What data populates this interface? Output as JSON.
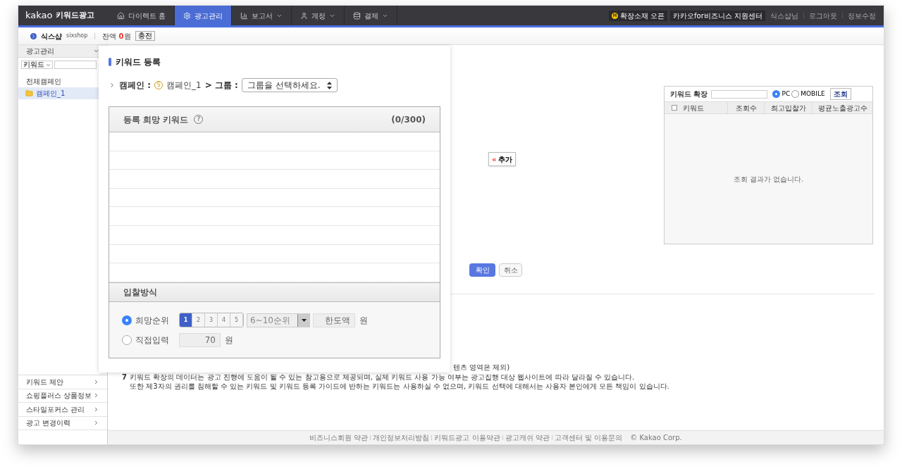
{
  "nav": {
    "logo_brand": "kakao",
    "logo_product": "키워드광고",
    "tabs": [
      {
        "label": "다이렉트 홈",
        "selected": false,
        "dropdown": false
      },
      {
        "label": "광고관리",
        "selected": true,
        "dropdown": false
      },
      {
        "label": "보고서",
        "selected": false,
        "dropdown": true
      },
      {
        "label": "계정",
        "selected": false,
        "dropdown": true
      },
      {
        "label": "결제",
        "selected": false,
        "dropdown": true
      }
    ],
    "badge_mark": "H",
    "badge": "확장소재 오픈",
    "support": "카카오for비즈니스 지원센터",
    "user_links": [
      "식스샵님",
      "로그아웃",
      "정보수정"
    ]
  },
  "account": {
    "name": "식스샵",
    "id": "sixshop",
    "balance_label": "잔액",
    "balance_amount": "0",
    "balance_unit": "원",
    "charge_button": "충전"
  },
  "sidebar": {
    "header": "광고관리",
    "search_select": "키워드",
    "tree": [
      {
        "label": "전체캠페인",
        "selected": false,
        "children": [
          {
            "label": "캠페인_1",
            "selected": true
          }
        ]
      }
    ],
    "menu": [
      "키워드 제안",
      "쇼핑플러스 상품정보",
      "스타일포커스 관리",
      "광고 변경이력"
    ]
  },
  "page": {
    "add_icon": "«",
    "add_button": "추가",
    "keyword_extension": {
      "label": "키워드 확장",
      "radios": [
        {
          "label": "PC",
          "selected": true
        },
        {
          "label": "MOBILE",
          "selected": false
        }
      ],
      "search_button": "조회",
      "select_all_checked": false,
      "columns": [
        "키워드",
        "조회수",
        "최고입찰가",
        "평균노출광고수"
      ],
      "empty": "조회 결과가 없습니다."
    },
    "confirm": "확인",
    "cancel": "취소",
    "notes_fragment": "텐츠 영역은 제외)",
    "note_number": "7",
    "note_lines": [
      "키워드 확장의 데이터는 광고 진행에 도움이 될 수 있는 참고용으로 제공되며, 실제 키워드 사용 가능 여부는 광고집행 대상 웹사이트에 따라 달라질 수 있습니다.",
      "또한 제3자의 권리를 침해할 수 있는 키워드 및 키워드 등록 가이드에 반하는 키워드는 사용하실 수 없으며, 키워드 선택에 대해서는 사용자 본인에게 모든 책임이 있습니다."
    ]
  },
  "footer": {
    "links": [
      "비즈니스회원 약관",
      "개인정보처리방침",
      "키워드광고 이용약관",
      "광고캐쉬 약관",
      "고객센터 및 이용문의"
    ],
    "copyright": "© Kakao Corp."
  },
  "modal": {
    "title": "키워드 등록",
    "campaign_label": "캠페인 :",
    "campaign_mark": "S",
    "campaign_name": "캠페인_1",
    "group_label": "> 그룹 :",
    "group_select": "그룹을 선택하세요.",
    "keywords_title": "등록 희망 키워드",
    "help": "?",
    "count": "(**0**/300)",
    "bid_title": "입찰방식",
    "bid_options": [
      {
        "kind": "rank",
        "label": "희망순위",
        "selected": true
      },
      {
        "kind": "direct",
        "label": "직접입력",
        "selected": false
      }
    ],
    "ranks": [
      {
        "label": "1",
        "selected": true
      },
      {
        "label": "2",
        "selected": false
      },
      {
        "label": "3",
        "selected": false
      },
      {
        "label": "4",
        "selected": false
      },
      {
        "label": "5",
        "selected": false
      }
    ],
    "rank_select": "6~10순위",
    "limit_value": "한도액",
    "limit_unit": "원",
    "direct_value": "70",
    "direct_unit": "원"
  }
}
